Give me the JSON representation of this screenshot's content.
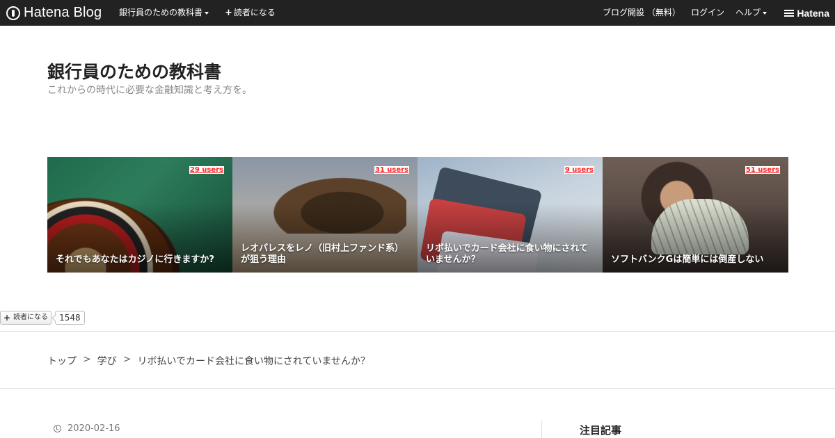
{
  "globalbar": {
    "logo_text": "Hatena Blog",
    "blog_menu": "銀行員のための教科書",
    "subscribe": "読者になる",
    "open_blog": "ブログ開設 （無料）",
    "login": "ログイン",
    "help": "ヘルプ",
    "brand": "Hatena",
    "icons": [
      "hatena-blog-logo-icon",
      "chevron-down-icon",
      "plus-icon",
      "hatena-logo-icon"
    ]
  },
  "blog": {
    "title": "銀行員のための教科書",
    "description": "これからの時代に必要な金融知識と考え方を。"
  },
  "featured": [
    {
      "users": "29 users",
      "title": "それでもあなたはカジノに行きますか?"
    },
    {
      "users": "31 users",
      "title": "レオパレスをレノ（旧村上ファンド系）が狙う理由"
    },
    {
      "users": "9 users",
      "title": "リボ払いでカード会社に食い物にされていませんか？"
    },
    {
      "users": "51 users",
      "title": "ソフトバンクGは簡単には倒産しない"
    }
  ],
  "subscribe_widget": {
    "label": "読者になる",
    "count": "1548"
  },
  "breadcrumb": [
    "トップ",
    "学び",
    "リボ払いでカード会社に食い物にされていませんか？"
  ],
  "breadcrumb_separator": ">",
  "entry": {
    "date": "2020-02-16"
  },
  "sidebar": {
    "section_title": "注目記事"
  },
  "colors": {
    "globalbar_bg": "#222222",
    "users_badge": "#ff2222",
    "text": "#333333"
  }
}
